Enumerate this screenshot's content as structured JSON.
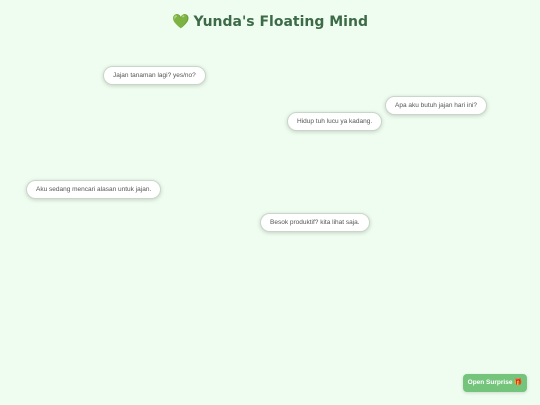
{
  "header": {
    "icon": "green-heart-icon",
    "icon_glyph": "💚",
    "title": "Yunda's Floating Mind"
  },
  "thoughts": [
    "Jajan tanaman lagi? yes/no?",
    "Apa aku butuh jajan hari ini?",
    "Hidup tuh lucu ya kadang.",
    "Aku sedang mencari alasan untuk jajan.",
    "Besok produktif? kita lihat saja."
  ],
  "surprise_button": {
    "label": "Open Surprise 🎁",
    "icon": "gift-icon"
  },
  "colors": {
    "background": "#effdf0",
    "title": "#3d6b47",
    "button": "#74c47c"
  }
}
